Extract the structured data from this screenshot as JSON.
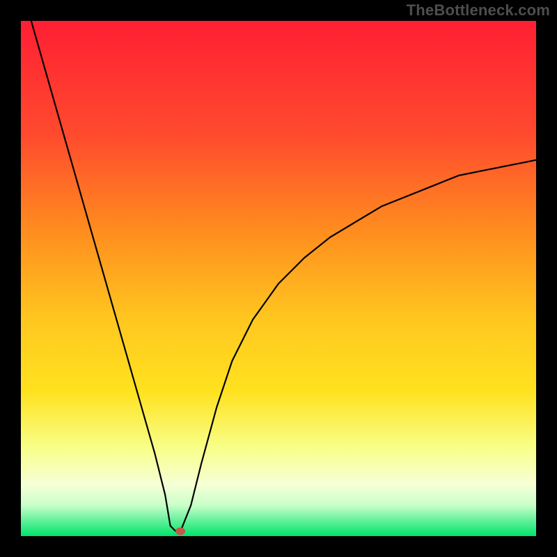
{
  "watermark": "TheBottleneck.com",
  "chart_data": {
    "type": "line",
    "title": "",
    "xlabel": "",
    "ylabel": "",
    "xlim": [
      0,
      100
    ],
    "ylim": [
      0,
      100
    ],
    "x": [
      2,
      4,
      6,
      8,
      10,
      12,
      14,
      16,
      18,
      20,
      22,
      24,
      26,
      28,
      29,
      30,
      31,
      33,
      35,
      38,
      41,
      45,
      50,
      55,
      60,
      65,
      70,
      75,
      80,
      85,
      90,
      95,
      100
    ],
    "values": [
      100,
      93,
      86,
      79,
      72,
      65,
      58,
      51,
      44,
      37,
      30,
      23,
      16,
      8,
      2,
      1,
      1,
      6,
      14,
      25,
      34,
      42,
      49,
      54,
      58,
      61,
      64,
      66,
      68,
      70,
      71,
      72,
      73
    ],
    "marker": {
      "x": 31,
      "y": 1
    },
    "colors": {
      "gradient_top": "#ff1f33",
      "gradient_mid_upper": "#ff8a1f",
      "gradient_mid": "#ffe21f",
      "gradient_mid_lower": "#f6ffb3",
      "gradient_bottom": "#00e56b",
      "curve": "#000000",
      "marker": "#c05a4a",
      "frame": "#000000"
    }
  }
}
